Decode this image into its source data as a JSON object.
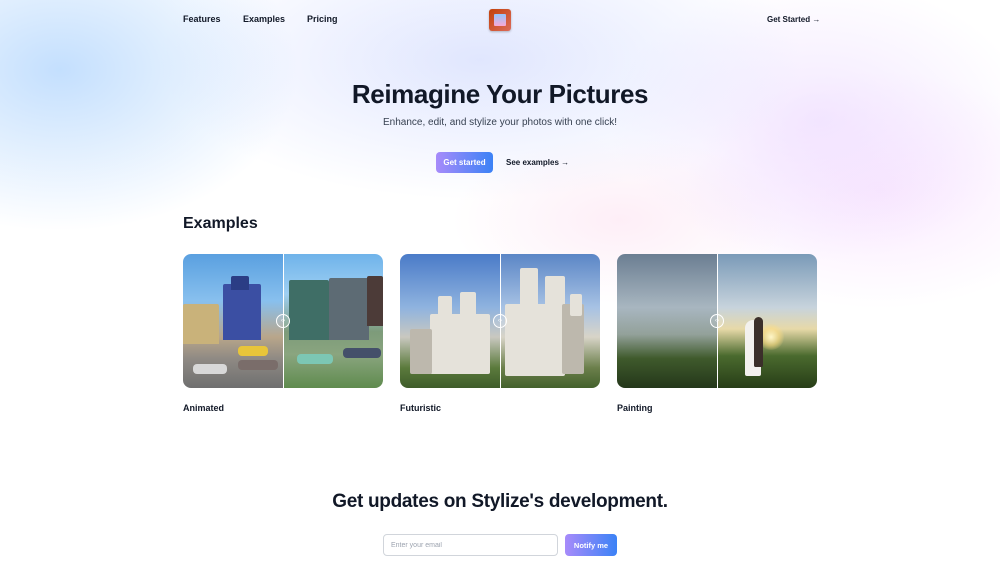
{
  "nav": {
    "links": [
      "Features",
      "Examples",
      "Pricing"
    ],
    "cta": "Get Started →",
    "logo_icon": "framed-picture-logo-icon"
  },
  "hero": {
    "title": "Reimagine Your Pictures",
    "subtitle": "Enhance, edit, and stylize your photos with one click!",
    "primary_button": "Get started",
    "secondary_link": "See examples →"
  },
  "examples": {
    "title": "Examples",
    "cards": [
      {
        "label": "Animated",
        "handle_icon": "compare-arrows-icon"
      },
      {
        "label": "Futuristic",
        "handle_icon": "compare-arrows-icon"
      },
      {
        "label": "Painting",
        "handle_icon": "compare-arrows-icon"
      }
    ]
  },
  "newsletter": {
    "title": "Get updates on Stylize's development.",
    "email_placeholder": "Enter your email",
    "button": "Notify me"
  },
  "colors": {
    "accent_gradient_start": "#a78bfa",
    "accent_gradient_end": "#3b82f6",
    "text": "#111827"
  }
}
